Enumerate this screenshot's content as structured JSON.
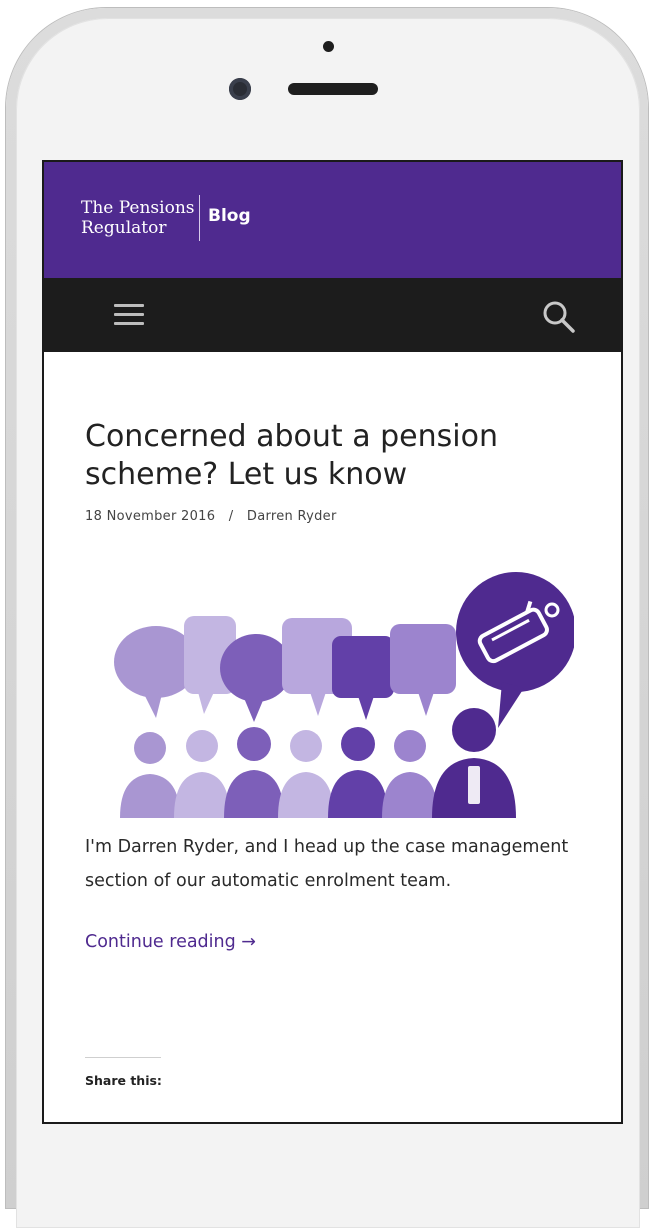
{
  "brand": {
    "logo_line1": "The Pensions",
    "logo_line2": "Regulator",
    "section": "Blog",
    "color": "#4f2a8f"
  },
  "nav": {
    "menu_icon": "hamburger-menu-icon",
    "search_icon": "search-icon"
  },
  "post": {
    "title": "Concerned about a pension scheme? Let us know",
    "date": "18 November 2016",
    "separator": "/",
    "author": "Darren Ryder",
    "excerpt": "I'm Darren Ryder, and I head up the case management section of our automatic enrolment team.",
    "continue_label": "Continue reading →"
  },
  "share": {
    "label": "Share this:"
  }
}
